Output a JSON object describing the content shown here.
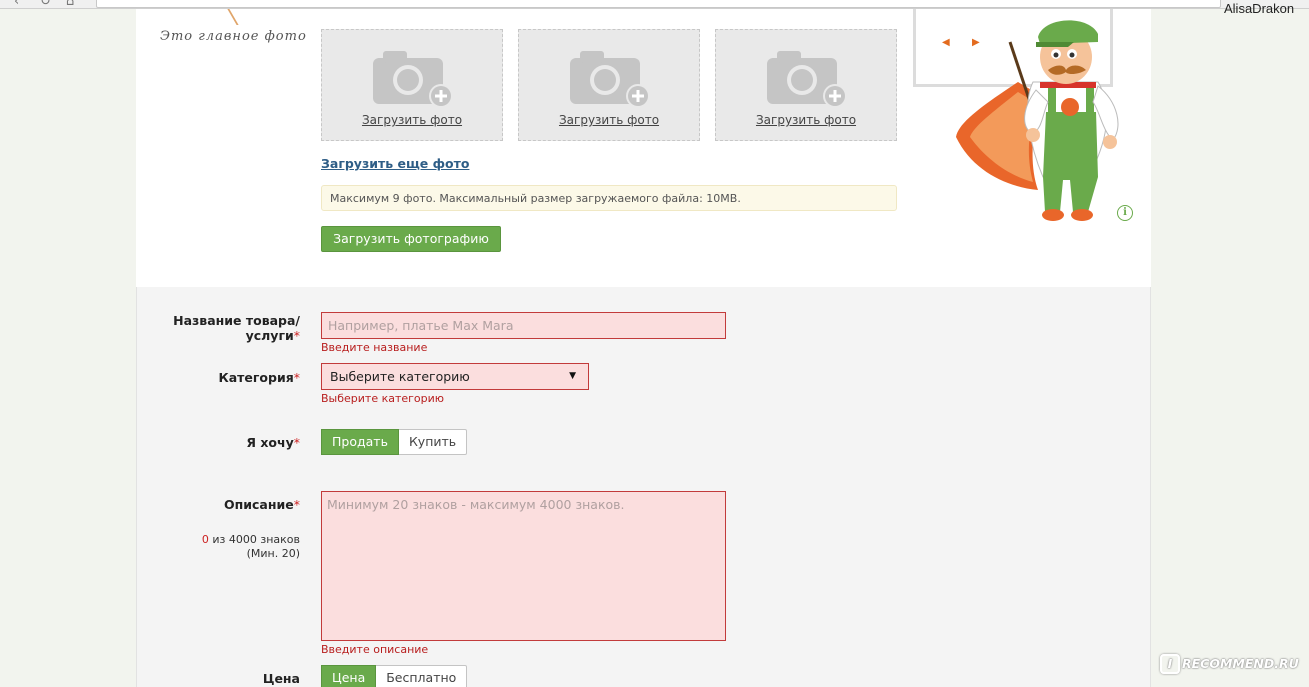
{
  "browser": {
    "user_name": "AlisaDrakon",
    "back_glyph": "‹",
    "reload_glyph": "↻",
    "home_glyph": "⌂"
  },
  "photos": {
    "main_photo_note": "Это главное фото",
    "slots": [
      {
        "label": "Загрузить фото",
        "icon": "camera-plus-icon"
      },
      {
        "label": "Загрузить фото",
        "icon": "camera-plus-icon"
      },
      {
        "label": "Загрузить фото",
        "icon": "camera-plus-icon"
      }
    ],
    "more_link": "Загрузить еще фото",
    "limit_note": "Максимум 9 фото. Максимальный размер загружаемого файла: 10MB.",
    "upload_button": "Загрузить фотографию"
  },
  "promo": {
    "prev_arrow": "◀",
    "next_arrow": "▶",
    "info_glyph": "i"
  },
  "form": {
    "title": {
      "label_line1": "Название товара/",
      "label_line2": "услуги",
      "required_mark": "*",
      "placeholder": "Например, платье Max Mara",
      "error": "Введите название"
    },
    "category": {
      "label": "Категория",
      "required_mark": "*",
      "selected": "Выберите категорию",
      "caret": "▼",
      "error": "Выберите категорию"
    },
    "intent": {
      "label": "Я хочу",
      "required_mark": "*",
      "options": [
        "Продать",
        "Купить"
      ],
      "active_index": 0
    },
    "description": {
      "label": "Описание",
      "required_mark": "*",
      "counter_value": "0",
      "counter_text": " из 4000 знаков",
      "counter_min": "(Мин. 20)",
      "placeholder": "Минимум 20 знаков - максимум 4000 знаков.",
      "error": "Введите описание"
    },
    "price": {
      "label": "Цена",
      "options": [
        "Цена",
        "Бесплатно"
      ],
      "active_index": 0
    }
  },
  "watermark": {
    "mark": "I",
    "text": "RECOMMEND.RU"
  },
  "colors": {
    "accent_green": "#6aaa4b",
    "error_red": "#b81e1e",
    "field_error_bg": "#fbdede",
    "link_blue": "#2e5d86",
    "arrow_orange": "#e36b1f"
  }
}
